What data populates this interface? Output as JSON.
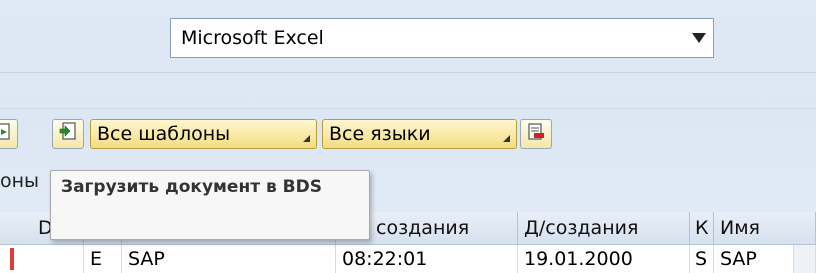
{
  "format_select": {
    "value": "Microsoft Excel"
  },
  "toolbar": {
    "template_filter": "Все шаблоны",
    "language_filter": "Все языки"
  },
  "tab_label": "оны",
  "tooltip": {
    "text": "Загрузить документ в BDS"
  },
  "table": {
    "headers": {
      "d": "D",
      "time": "создания",
      "date": "Д/создания",
      "k": "К",
      "name": "Имя"
    },
    "row": {
      "e": "E",
      "name1": "SAP",
      "time": "08:22:01",
      "date": "19.01.2000",
      "k": "S",
      "name": "SAP"
    }
  },
  "colors": {
    "background": "#dce7f4",
    "button_yellow": "#f3dd82",
    "tooltip_bg": "#f7f7f7"
  }
}
